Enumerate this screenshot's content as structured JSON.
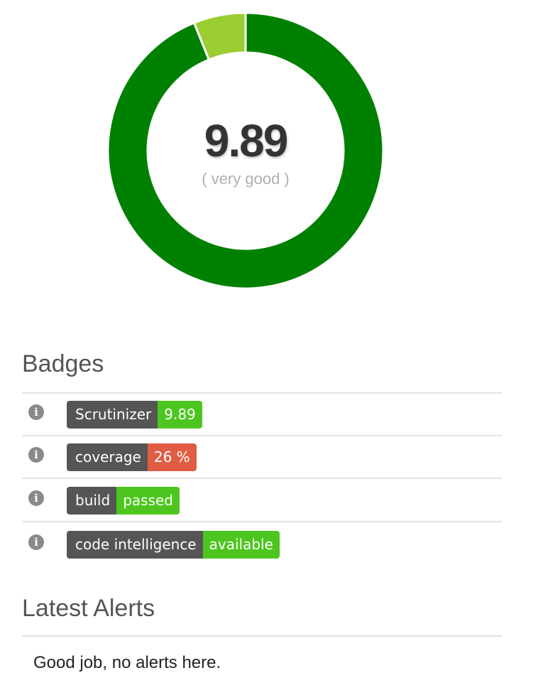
{
  "score": {
    "value": "9.89",
    "rating": "( very good )",
    "fraction": 0.939,
    "colors": {
      "main": "#008000",
      "remainder": "#9acd32",
      "separator": "#ffffff"
    }
  },
  "badges_section": {
    "title": "Badges",
    "info_icon": "info-circle-icon",
    "items": [
      {
        "label": "Scrutinizer",
        "value": "9.89",
        "color": "#4cc61e"
      },
      {
        "label": "coverage",
        "value": "26 %",
        "color": "#e05d44"
      },
      {
        "label": "build",
        "value": "passed",
        "color": "#4cc61e"
      },
      {
        "label": "code intelligence",
        "value": "available",
        "color": "#4cc61e"
      }
    ]
  },
  "alerts_section": {
    "title": "Latest Alerts",
    "message": "Good job, no alerts here."
  }
}
